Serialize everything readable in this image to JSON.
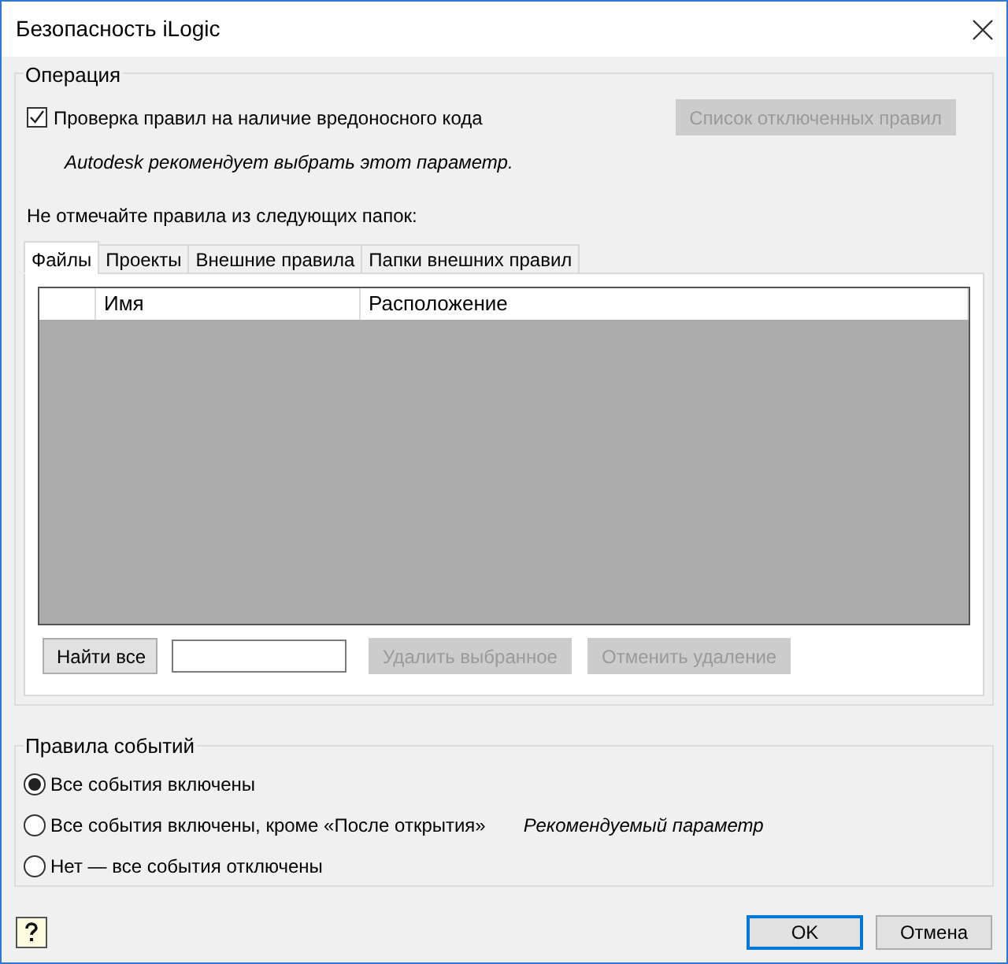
{
  "window": {
    "title": "Безопасность iLogic"
  },
  "operation": {
    "legend": "Операция",
    "checkbox": {
      "label": "Проверка правил на наличие вредоносного кода",
      "checked": true
    },
    "disabled_rules_button": {
      "label": "Список отключенных правил",
      "disabled": true
    },
    "hint": "Autodesk рекомендует выбрать этот параметр.",
    "folders_label": "Не отмечайте правила из следующих папок:",
    "tabs": [
      {
        "label": "Файлы",
        "selected": true
      },
      {
        "label": "Проекты",
        "selected": false
      },
      {
        "label": "Внешние правила",
        "selected": false
      },
      {
        "label": "Папки внешних правил",
        "selected": false
      }
    ],
    "table": {
      "columns": [
        "Имя",
        "Расположение"
      ]
    },
    "find_all_button": {
      "label": "Найти все",
      "disabled": false
    },
    "action_buttons": [
      {
        "label": "Удалить выбранное",
        "disabled": true
      },
      {
        "label": "Отменить удаление",
        "disabled": true
      }
    ]
  },
  "events": {
    "legend": "Правила событий",
    "radios": [
      {
        "label": "Все события включены",
        "selected": true
      },
      {
        "label": "Все события включены, кроме «После открытия»",
        "selected": false,
        "note": "Рекомендуемый параметр"
      },
      {
        "label": "Нет — все события отключены",
        "selected": false
      }
    ]
  },
  "footer": {
    "buttons": [
      {
        "label": "OK",
        "default": true
      },
      {
        "label": "Отмена",
        "default": false
      }
    ]
  }
}
